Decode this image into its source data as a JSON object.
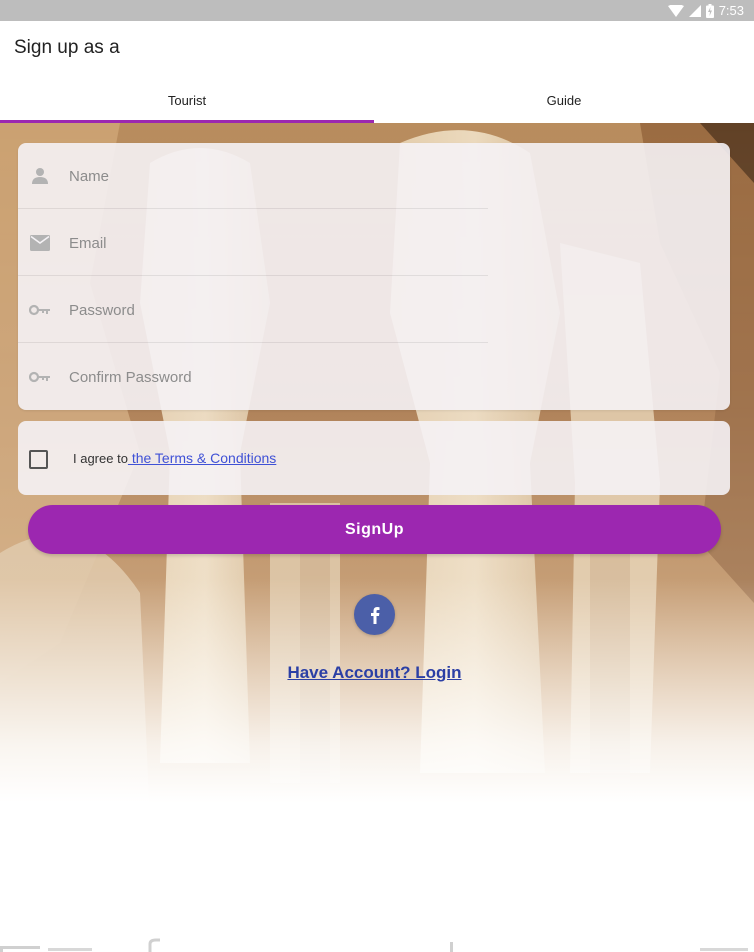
{
  "status_bar": {
    "time": "7:53",
    "icons": [
      "wifi-icon",
      "signal-icon",
      "battery-icon"
    ]
  },
  "app_bar": {
    "title": "Sign up as a",
    "tabs": [
      {
        "label": "Tourist",
        "selected": true
      },
      {
        "label": "Guide",
        "selected": false
      }
    ]
  },
  "form": {
    "fields": [
      {
        "placeholder": "Name",
        "icon": "person-icon",
        "value": ""
      },
      {
        "placeholder": "Email",
        "icon": "mail-icon",
        "value": ""
      },
      {
        "placeholder": "Password",
        "icon": "key-icon",
        "value": ""
      },
      {
        "placeholder": "Confirm Password",
        "icon": "key-icon",
        "value": ""
      }
    ]
  },
  "terms": {
    "checked": false,
    "prefix": "I agree to",
    "link": " the Terms & Conditions"
  },
  "signup_button": {
    "label": "SignUp"
  },
  "facebook_button": {
    "icon": "facebook-icon"
  },
  "login_link": {
    "label": "Have Account? Login"
  },
  "colors": {
    "accent": "#9c27b0",
    "facebook": "#4b5fa8",
    "link": "#3f51d6",
    "status_bar": "#bdbdbd"
  }
}
